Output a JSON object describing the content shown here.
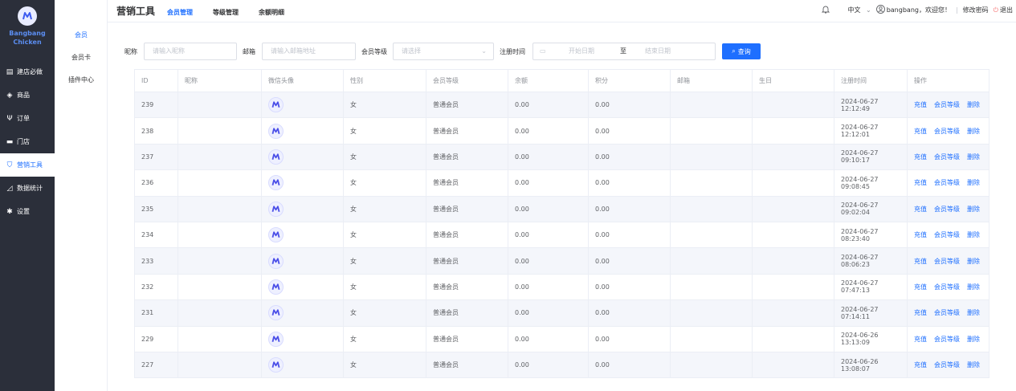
{
  "brand": {
    "name_line1": "Bangbang",
    "name_line2": "Chicken"
  },
  "nav": [
    {
      "label": "建店必做",
      "icon": "clipboard-icon"
    },
    {
      "label": "商品",
      "icon": "box-icon"
    },
    {
      "label": "订单",
      "icon": "fork-knife-icon"
    },
    {
      "label": "门店",
      "icon": "store-icon"
    },
    {
      "label": "营销工具",
      "icon": "marketing-icon"
    },
    {
      "label": "数据统计",
      "icon": "chart-icon"
    },
    {
      "label": "设置",
      "icon": "gear-icon"
    }
  ],
  "subnav": [
    {
      "label": "会员"
    },
    {
      "label": "会员卡"
    },
    {
      "label": "插件中心"
    }
  ],
  "top": {
    "title": "营销工具",
    "tabs": [
      {
        "label": "会员管理"
      },
      {
        "label": "等级管理"
      },
      {
        "label": "余额明细"
      }
    ],
    "lang": "中文",
    "welcome": "bangbang，欢迎您！",
    "sep": "|",
    "change_password": "修改密码",
    "logout": "退出"
  },
  "filter": {
    "nickname_label": "昵称",
    "nickname_placeholder": "请输入昵称",
    "email_label": "邮箱",
    "email_placeholder": "请输入邮箱地址",
    "level_label": "会员等级",
    "level_placeholder": "请选择",
    "regtime_label": "注册时间",
    "start_placeholder": "开始日期",
    "to": "至",
    "end_placeholder": "结束日期",
    "query_label": "查询"
  },
  "table": {
    "columns": [
      "ID",
      "昵称",
      "微信头像",
      "性别",
      "会员等级",
      "余额",
      "积分",
      "邮箱",
      "生日",
      "注册时间",
      "操作"
    ],
    "actions": [
      "充值",
      "会员等级",
      "删除"
    ],
    "rows": [
      {
        "id": "239",
        "nickname": "",
        "gender": "女",
        "level": "普通会员",
        "balance": "0.00",
        "points": "0.00",
        "email": "",
        "birthday": "",
        "regtime": "2024-06-27 12:12:49"
      },
      {
        "id": "238",
        "nickname": "",
        "gender": "女",
        "level": "普通会员",
        "balance": "0.00",
        "points": "0.00",
        "email": "",
        "birthday": "",
        "regtime": "2024-06-27 12:12:01"
      },
      {
        "id": "237",
        "nickname": "",
        "gender": "女",
        "level": "普通会员",
        "balance": "0.00",
        "points": "0.00",
        "email": "",
        "birthday": "",
        "regtime": "2024-06-27 09:10:17"
      },
      {
        "id": "236",
        "nickname": "",
        "gender": "女",
        "level": "普通会员",
        "balance": "0.00",
        "points": "0.00",
        "email": "",
        "birthday": "",
        "regtime": "2024-06-27 09:08:45"
      },
      {
        "id": "235",
        "nickname": "",
        "gender": "女",
        "level": "普通会员",
        "balance": "0.00",
        "points": "0.00",
        "email": "",
        "birthday": "",
        "regtime": "2024-06-27 09:02:04"
      },
      {
        "id": "234",
        "nickname": "",
        "gender": "女",
        "level": "普通会员",
        "balance": "0.00",
        "points": "0.00",
        "email": "",
        "birthday": "",
        "regtime": "2024-06-27 08:23:40"
      },
      {
        "id": "233",
        "nickname": "",
        "gender": "女",
        "level": "普通会员",
        "balance": "0.00",
        "points": "0.00",
        "email": "",
        "birthday": "",
        "regtime": "2024-06-27 08:06:23"
      },
      {
        "id": "232",
        "nickname": "",
        "gender": "女",
        "level": "普通会员",
        "balance": "0.00",
        "points": "0.00",
        "email": "",
        "birthday": "",
        "regtime": "2024-06-27 07:47:13"
      },
      {
        "id": "231",
        "nickname": "",
        "gender": "女",
        "level": "普通会员",
        "balance": "0.00",
        "points": "0.00",
        "email": "",
        "birthday": "",
        "regtime": "2024-06-27 07:14:11"
      },
      {
        "id": "229",
        "nickname": "",
        "gender": "女",
        "level": "普通会员",
        "balance": "0.00",
        "points": "0.00",
        "email": "",
        "birthday": "",
        "regtime": "2024-06-26 13:13:09"
      },
      {
        "id": "227",
        "nickname": "",
        "gender": "女",
        "level": "普通会员",
        "balance": "0.00",
        "points": "0.00",
        "email": "",
        "birthday": "",
        "regtime": "2024-06-26 13:08:07"
      }
    ]
  },
  "colors": {
    "accent": "#1e6fff",
    "sidebar_bg": "#2b2f3a",
    "brand_text": "#5b8df0",
    "stripe": "#f4f6fb"
  }
}
